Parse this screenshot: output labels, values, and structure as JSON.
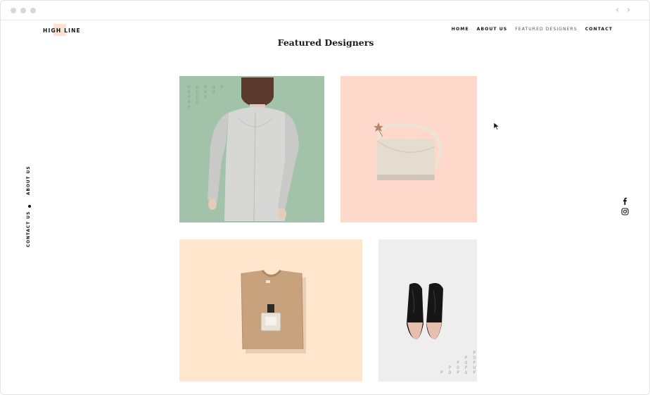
{
  "window": {
    "traffic_lights": [
      "close",
      "minimize",
      "zoom"
    ],
    "back_icon": "chevron-left-icon",
    "forward_icon": "chevron-right-icon"
  },
  "header": {
    "logo_text": "HIGH LINE",
    "nav": [
      {
        "label": "HOME"
      },
      {
        "label": "ABOUT US"
      },
      {
        "label": "FEATURED DESIGNERS"
      },
      {
        "label": "CONTACT"
      }
    ]
  },
  "main": {
    "title": "Featured Designers"
  },
  "side_nav": {
    "items": [
      {
        "label": "ABOUT US"
      },
      {
        "label": "CONTACT US"
      }
    ]
  },
  "social": {
    "icons": [
      "facebook-icon",
      "instagram-icon"
    ]
  },
  "gallery": {
    "tiles": [
      {
        "name": "coat",
        "background": "#a3c2aa",
        "popup_text": "P O P U P\nP O P U\nP O P\nP O\nP"
      },
      {
        "name": "bag",
        "background": "#fdd8cb"
      },
      {
        "name": "sweater",
        "background": "#ffe6cd"
      },
      {
        "name": "shoes",
        "background": "#efeeef",
        "popup_text": "        P\n      P O\n    P O P\n  P O P U\nP O P U P"
      }
    ]
  },
  "colors": {
    "text": "#111111",
    "logo_accent": "#fbe2d3",
    "border": "#e3e3e3"
  }
}
